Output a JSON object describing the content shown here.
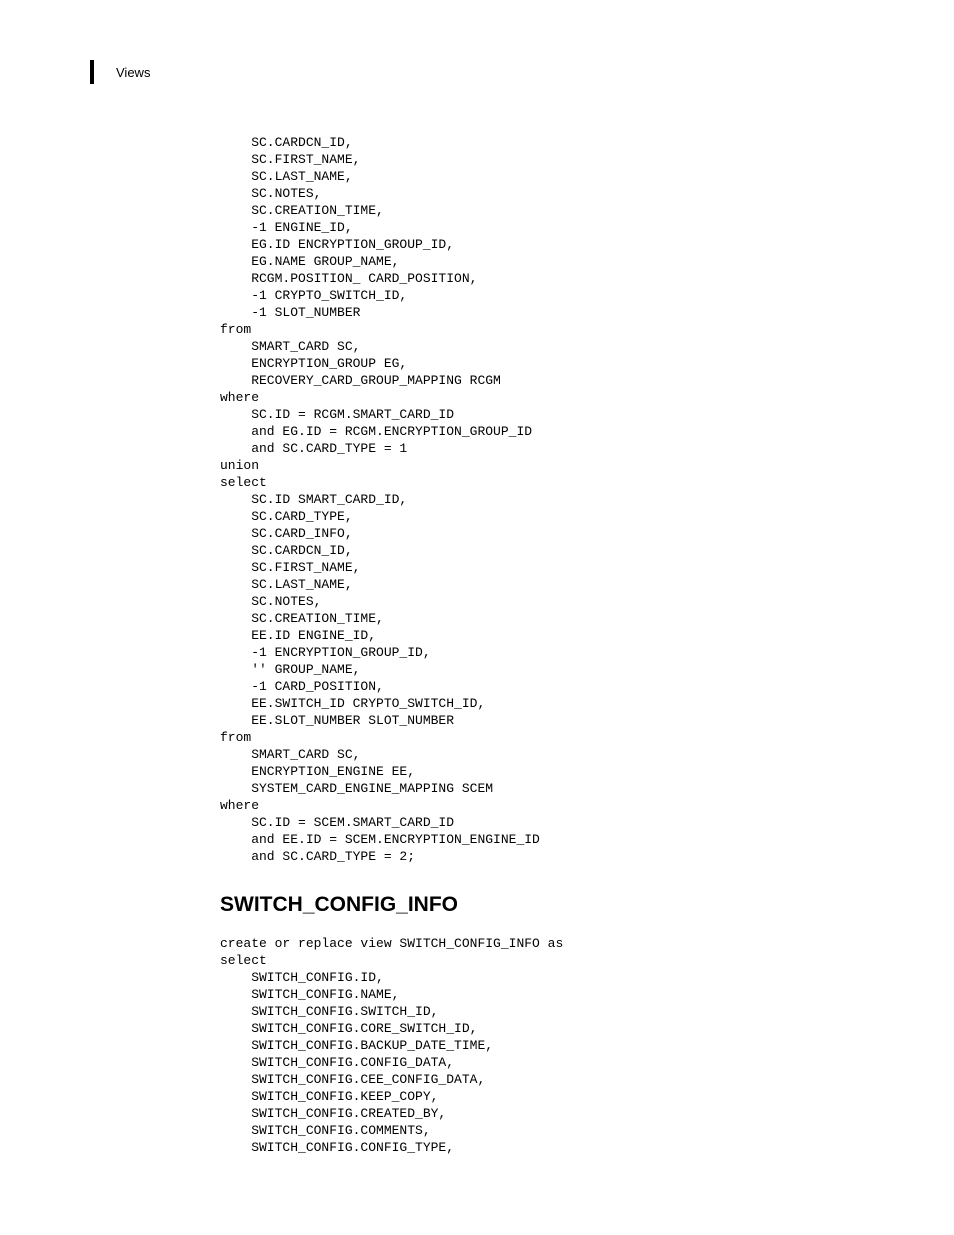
{
  "header": {
    "section": "Views"
  },
  "code1": "    SC.CARDCN_ID,\n    SC.FIRST_NAME,\n    SC.LAST_NAME,\n    SC.NOTES,\n    SC.CREATION_TIME,\n    -1 ENGINE_ID,\n    EG.ID ENCRYPTION_GROUP_ID,\n    EG.NAME GROUP_NAME,\n    RCGM.POSITION_ CARD_POSITION,\n    -1 CRYPTO_SWITCH_ID,\n    -1 SLOT_NUMBER\nfrom\n    SMART_CARD SC,\n    ENCRYPTION_GROUP EG,\n    RECOVERY_CARD_GROUP_MAPPING RCGM\nwhere\n    SC.ID = RCGM.SMART_CARD_ID\n    and EG.ID = RCGM.ENCRYPTION_GROUP_ID\n    and SC.CARD_TYPE = 1\nunion\nselect\n    SC.ID SMART_CARD_ID,\n    SC.CARD_TYPE,\n    SC.CARD_INFO,\n    SC.CARDCN_ID,\n    SC.FIRST_NAME,\n    SC.LAST_NAME,\n    SC.NOTES,\n    SC.CREATION_TIME,\n    EE.ID ENGINE_ID,\n    -1 ENCRYPTION_GROUP_ID,\n    '' GROUP_NAME,\n    -1 CARD_POSITION,\n    EE.SWITCH_ID CRYPTO_SWITCH_ID,\n    EE.SLOT_NUMBER SLOT_NUMBER\nfrom\n    SMART_CARD SC,\n    ENCRYPTION_ENGINE EE,\n    SYSTEM_CARD_ENGINE_MAPPING SCEM\nwhere\n    SC.ID = SCEM.SMART_CARD_ID\n    and EE.ID = SCEM.ENCRYPTION_ENGINE_ID\n    and SC.CARD_TYPE = 2;",
  "heading1": "SWITCH_CONFIG_INFO",
  "code2": "create or replace view SWITCH_CONFIG_INFO as\nselect\n    SWITCH_CONFIG.ID,\n    SWITCH_CONFIG.NAME,\n    SWITCH_CONFIG.SWITCH_ID,\n    SWITCH_CONFIG.CORE_SWITCH_ID,\n    SWITCH_CONFIG.BACKUP_DATE_TIME,\n    SWITCH_CONFIG.CONFIG_DATA,\n    SWITCH_CONFIG.CEE_CONFIG_DATA,\n    SWITCH_CONFIG.KEEP_COPY,\n    SWITCH_CONFIG.CREATED_BY,\n    SWITCH_CONFIG.COMMENTS,\n    SWITCH_CONFIG.CONFIG_TYPE,"
}
